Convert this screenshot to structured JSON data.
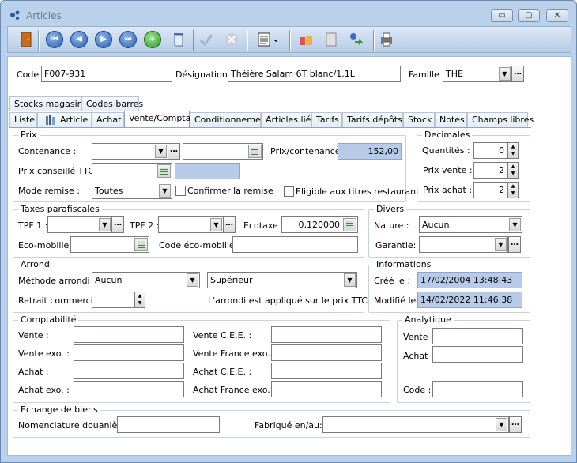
{
  "window": {
    "title": "Articles",
    "buttons": {
      "minimize": "▭",
      "maximize": "▢",
      "close": "✕"
    }
  },
  "toolbar": {
    "icons": [
      "exit-door-icon",
      "first-record-icon",
      "previous-record-icon",
      "next-record-icon",
      "last-record-icon",
      "add-record-icon",
      "delete-record-icon",
      "validate-icon",
      "cancel-icon",
      "report-menu-icon",
      "cart-icon",
      "copy-icon",
      "transfer-icon",
      "print-icon"
    ]
  },
  "header": {
    "code_label": "Code :",
    "code_value": "F007-931",
    "designation_label": "Désignation :",
    "designation_value": "Théière Salam 6T blanc/1.1L",
    "famille_label": "Famille :",
    "famille_value": "THE"
  },
  "tabs_row1": [
    "Stocks magasins",
    "Codes barres"
  ],
  "tabs_row2": [
    "Liste",
    "Article",
    "Achat",
    "Vente/Compta",
    "Conditionnement",
    "Articles liés",
    "Tarifs",
    "Tarifs dépôts",
    "Stock",
    "Notes",
    "Champs libres"
  ],
  "active_tab": "Vente/Compta",
  "prix": {
    "title": "Prix",
    "contenance_label": "Contenance :",
    "contenance_value": "",
    "prix_contenance_label": "Prix/contenance :",
    "prix_contenance_value": "152,00",
    "prix_conseille_label": "Prix conseillé TTC :",
    "mode_remise_label": "Mode remise :",
    "mode_remise_value": "Toutes",
    "confirmer_label": "Confirmer la remise",
    "eligible_label": "Eligible aux titres restaurant"
  },
  "decimales": {
    "title": "Decimales",
    "quantites_label": "Quantités :",
    "quantites_value": "0",
    "prix_vente_label": "Prix vente :",
    "prix_vente_value": "2",
    "prix_achat_label": "Prix achat :",
    "prix_achat_value": "2"
  },
  "taxes": {
    "title": "Taxes parafiscales",
    "tpf1_label": "TPF 1 :",
    "tpf2_label": "TPF 2 :",
    "ecotaxe_label": "Ecotaxe :",
    "ecotaxe_value": "0,120000",
    "ecomobilier_label": "Eco-mobilier :",
    "code_ecomobilier_label": "Code éco-mobilier :"
  },
  "divers": {
    "title": "Divers",
    "nature_label": "Nature :",
    "nature_value": "Aucun",
    "garantie_label": "Garantie:"
  },
  "arrondi": {
    "title": "Arrondi",
    "methode_label": "Méthode arrondi :",
    "methode_value": "Aucun",
    "sens_value": "Supérieur",
    "retrait_label": "Retrait commercial :",
    "note": "L'arrondi est appliqué sur le prix TTC."
  },
  "informations": {
    "title": "Informations",
    "cree_label": "Créé le :",
    "cree_value": "17/02/2004 13:48:43",
    "modifie_label": "Modifié le :",
    "modifie_value": "14/02/2022 11:46:38"
  },
  "comptabilite": {
    "title": "Comptabilité",
    "vente_label": "Vente :",
    "vente_exo_label": "Vente exo. :",
    "achat_label": "Achat :",
    "achat_exo_label": "Achat exo. :",
    "vente_cee_label": "Vente C.E.E. :",
    "vente_france_exo_label": "Vente France exo. :",
    "achat_cee_label": "Achat C.E.E. :",
    "achat_france_exo_label": "Achat France exo. :"
  },
  "analytique": {
    "title": "Analytique",
    "vente_label": "Vente :",
    "achat_label": "Achat :",
    "code_label": "Code :"
  },
  "echange": {
    "title": "Echange de biens",
    "nomenclature_label": "Nomenclature douanière:",
    "fabrique_label": "Fabriqué en/au:"
  }
}
